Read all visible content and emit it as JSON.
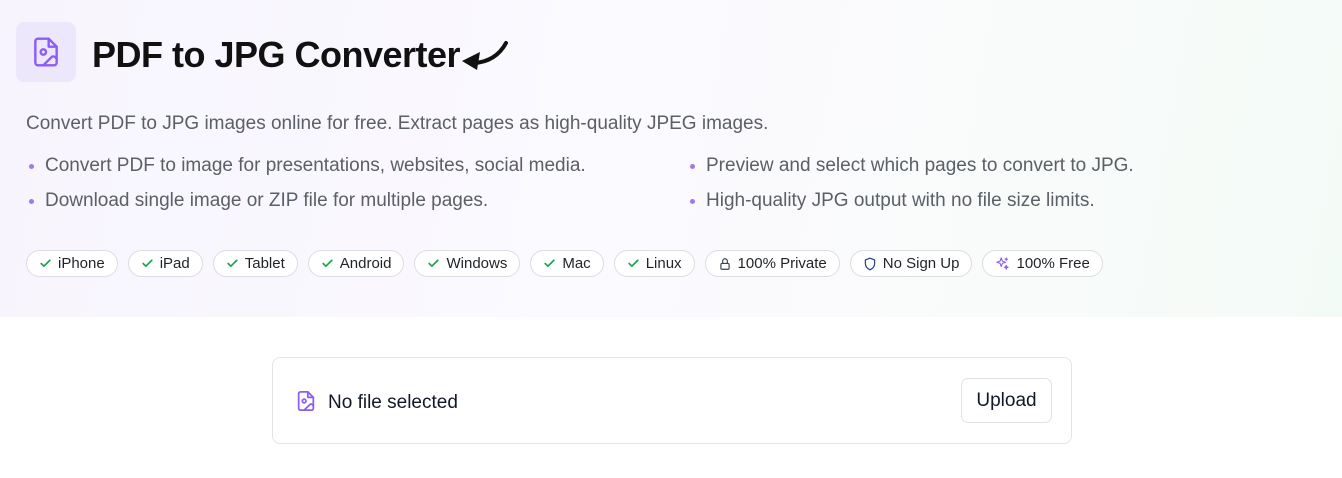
{
  "header": {
    "title": "PDF to JPG Converter",
    "logo_icon": "file-image-icon",
    "arrow_icon": "curved-arrow-left-icon",
    "accent_color": "#8b5cf6"
  },
  "description": "Convert PDF to JPG images online for free. Extract pages as high-quality JPEG images.",
  "features": [
    "Convert PDF to image for presentations, websites, social media.",
    "Download single image or ZIP file for multiple pages.",
    "Preview and select which pages to convert to JPG.",
    "High-quality JPG output with no file size limits."
  ],
  "badges": [
    {
      "label": "iPhone",
      "icon": "check-icon"
    },
    {
      "label": "iPad",
      "icon": "check-icon"
    },
    {
      "label": "Tablet",
      "icon": "check-icon"
    },
    {
      "label": "Android",
      "icon": "check-icon"
    },
    {
      "label": "Windows",
      "icon": "check-icon"
    },
    {
      "label": "Mac",
      "icon": "check-icon"
    },
    {
      "label": "Linux",
      "icon": "check-icon"
    },
    {
      "label": "100% Private",
      "icon": "lock-icon"
    },
    {
      "label": "No Sign Up",
      "icon": "shield-icon"
    },
    {
      "label": "100% Free",
      "icon": "sparkles-icon"
    }
  ],
  "upload": {
    "file_status": "No file selected",
    "button_label": "Upload",
    "icon": "file-image-icon"
  }
}
